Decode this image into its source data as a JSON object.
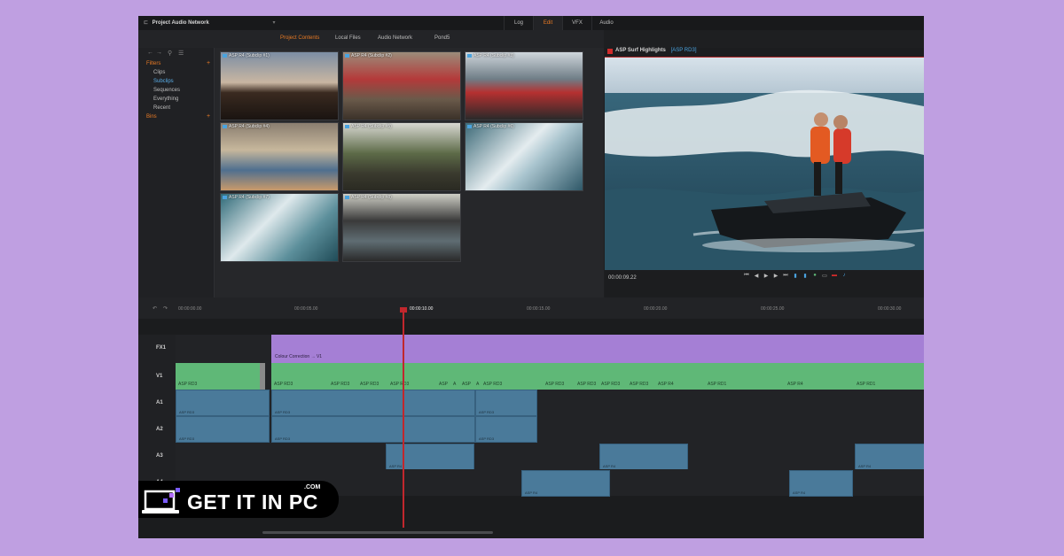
{
  "app": {
    "project_title": "Project Audio Network",
    "modes": [
      "Log",
      "Edit",
      "VFX",
      "Audio"
    ],
    "active_mode": "Edit"
  },
  "source_tabs": [
    "Project Contents",
    "Local Files",
    "Audio Network",
    "Pond5"
  ],
  "sidebar": {
    "filters_label": "Filters",
    "items": [
      "Clips",
      "Subclips",
      "Sequences",
      "Everything",
      "Recent"
    ],
    "active_item": "Subclips",
    "bins_label": "Bins",
    "plus": "+"
  },
  "thumbnails": [
    {
      "label": "ASP R4 (Subclip #1)"
    },
    {
      "label": "ASP R4 (Subclip #2)"
    },
    {
      "label": "ASP R4 (Subclip #3)"
    },
    {
      "label": "ASP R4 (Subclip #4)"
    },
    {
      "label": "ASP R4 (Subclip #5)"
    },
    {
      "label": "ASP R4 (Subclip #6)"
    },
    {
      "label": "ASP R4 (Subclip #7)"
    },
    {
      "label": "ASP R4 (Subclip #8)"
    }
  ],
  "viewer": {
    "title": "ASP Surf Highlights",
    "clip": "[ASP RD3]",
    "timecode": "00:00:09.22"
  },
  "timeline": {
    "ruler": [
      "00:00:00.00",
      "00:00:05.00",
      "00:00:10.00",
      "00:00:15.00",
      "00:00:20.00",
      "00:00:25.00",
      "00:00:30.00"
    ],
    "playhead_label": "00:00:10.00",
    "tracks": [
      "FX1",
      "V1",
      "A1",
      "A2",
      "A3",
      "A4"
    ],
    "fx_clip": "Colour Correction → V1",
    "v1_clips": [
      "ASP RD3",
      "ASP RD3",
      "ASP RD3",
      "ASP RD3",
      "ASP RD3",
      "ASP",
      "A",
      "ASP",
      "A",
      "ASP RD3",
      "ASP RD3",
      "ASP RD3",
      "ASP RD3",
      "ASP RD3",
      "ASP R4",
      "ASP RD1",
      "ASP R4",
      "ASP RD1"
    ],
    "a1_clips": [
      "ASP RD3",
      "ASP RD3",
      "ASP RD3"
    ],
    "a2_clips": [
      "ASP RD3",
      "ASP RD3",
      "ASP RD3"
    ],
    "a3_clips": [
      "ASP R4",
      "ASP R4",
      "ASP R4"
    ],
    "a4_clips": [
      "ASP R4",
      "ASP R4"
    ]
  },
  "watermark": {
    "text": "GET IT IN PC",
    "suffix": ".COM"
  },
  "colors": {
    "accent_orange": "#e87a24",
    "fx_purple": "#a57fd5",
    "video_green": "#5fb877",
    "audio_blue": "#4a7a9a",
    "playhead_red": "#c1272d"
  }
}
